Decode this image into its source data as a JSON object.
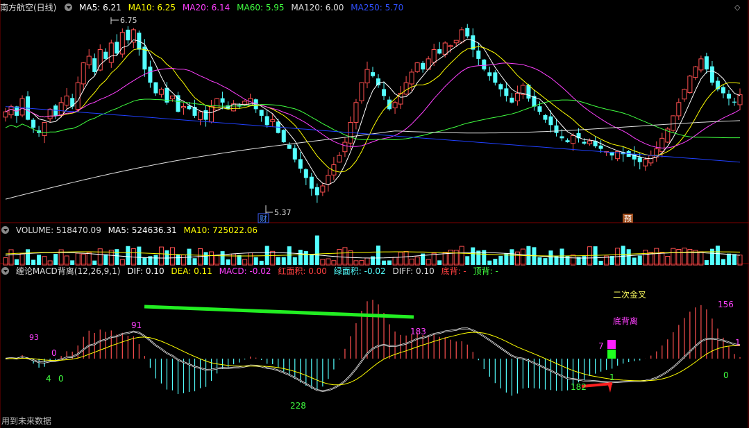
{
  "main_header": {
    "title": "南方航空(日线)",
    "ma5": "MA5: 6.21",
    "ma10": "MA10: 6.25",
    "ma20": "MA20: 6.14",
    "ma60": "MA60: 5.95",
    "ma120": "MA120: 6.00",
    "ma250": "MA250: 5.70"
  },
  "vol_header": {
    "volume": "VOLUME: 518470.09",
    "ma5": "MA5: 524636.31",
    "ma10": "MA10: 725022.06"
  },
  "macd_header": {
    "title": "缠论MACD背离(12,26,9,1)",
    "dif": "DIF: 0.10",
    "dea": "DEA: 0.11",
    "macd": "MACD: -0.02",
    "red_area": "红面积: 0.00",
    "green_area": "绿面积: -0.02",
    "diff": "DIFF: 0.10",
    "bottom_div": "底背: -",
    "top_div": "顶背: -"
  },
  "annotations": {
    "high_label": "6.75",
    "low_label": "5.37",
    "cai_tag": "财",
    "yu_tag": "预",
    "second_cross": "二次金叉",
    "bottom_divergence": "底背离",
    "n91": "91",
    "n183": "183",
    "n228": "228",
    "n156": "156",
    "n182": "182",
    "n0a": "0",
    "n0b": "0",
    "n0c": "0",
    "n4": "4",
    "n1a": "1",
    "n1b": "1",
    "n7": "7",
    "n93": "93"
  },
  "footer": "用到未来数据",
  "colors": {
    "up": "#ff5050",
    "down": "#54ffff",
    "ma5": "#ffffff",
    "ma10": "#ffff00",
    "ma20": "#ff40ff",
    "ma60": "#40ff40",
    "ma120": "#e0e0e0",
    "ma250": "#2040ff"
  },
  "chart_data": {
    "type": "candlestick",
    "series_meta": [
      "MA5",
      "MA10",
      "MA20",
      "MA60",
      "MA120",
      "MA250"
    ],
    "high": 6.75,
    "low": 5.37,
    "last": {
      "ma5": 6.21,
      "ma10": 6.25,
      "ma20": 6.14,
      "ma60": 5.95,
      "ma120": 6.0,
      "ma250": 5.7
    },
    "volume_last": {
      "volume": 518470.09,
      "ma5": 524636.31,
      "ma10": 725022.06
    },
    "macd_last": {
      "dif": 0.1,
      "dea": 0.11,
      "macd": -0.02
    },
    "close": [
      6.08,
      6.12,
      6.05,
      6.18,
      6.02,
      5.96,
      5.92,
      6.0,
      6.1,
      6.05,
      6.15,
      6.2,
      6.12,
      6.3,
      6.45,
      6.5,
      6.38,
      6.55,
      6.48,
      6.6,
      6.52,
      6.68,
      6.62,
      6.7,
      6.55,
      6.4,
      6.3,
      6.22,
      6.25,
      6.15,
      6.2,
      6.08,
      6.12,
      6.1,
      6.05,
      6.08,
      6.02,
      6.12,
      6.18,
      6.15,
      6.1,
      6.14,
      6.12,
      6.16,
      6.18,
      6.1,
      6.05,
      5.98,
      6.02,
      5.92,
      5.85,
      5.8,
      5.72,
      5.65,
      5.58,
      5.5,
      5.45,
      5.52,
      5.6,
      5.68,
      5.75,
      5.85,
      6.0,
      6.15,
      6.3,
      6.4,
      6.35,
      6.28,
      6.2,
      6.1,
      6.15,
      6.22,
      6.3,
      6.38,
      6.45,
      6.4,
      6.48,
      6.55,
      6.52,
      6.6,
      6.58,
      6.62,
      6.7,
      6.65,
      6.55,
      6.48,
      6.4,
      6.35,
      6.3,
      6.25,
      6.2,
      6.15,
      6.22,
      6.28,
      6.18,
      6.12,
      6.08,
      6.02,
      5.98,
      5.92,
      5.88,
      5.85,
      5.9,
      5.88,
      5.84,
      5.86,
      5.82,
      5.8,
      5.78,
      5.75,
      5.78,
      5.76,
      5.74,
      5.72,
      5.7,
      5.72,
      5.75,
      5.8,
      5.88,
      5.95,
      6.05,
      6.15,
      6.25,
      6.35,
      6.42,
      6.48,
      6.4,
      6.3,
      6.25,
      6.22,
      6.18,
      6.15,
      6.21
    ]
  }
}
